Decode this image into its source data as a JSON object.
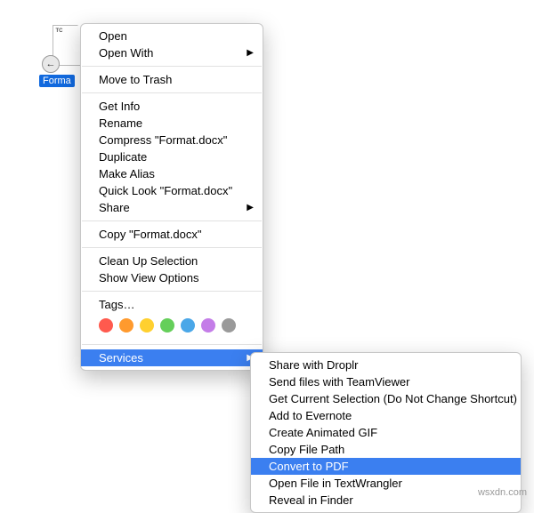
{
  "file": {
    "badge": "TC",
    "recent_glyph": "←",
    "label": "Forma"
  },
  "primary_menu": {
    "groups": [
      {
        "items": [
          {
            "label": "Open",
            "submenu": false
          },
          {
            "label": "Open With",
            "submenu": true
          }
        ]
      },
      {
        "items": [
          {
            "label": "Move to Trash",
            "submenu": false
          }
        ]
      },
      {
        "items": [
          {
            "label": "Get Info",
            "submenu": false
          },
          {
            "label": "Rename",
            "submenu": false
          },
          {
            "label": "Compress \"Format.docx\"",
            "submenu": false
          },
          {
            "label": "Duplicate",
            "submenu": false
          },
          {
            "label": "Make Alias",
            "submenu": false
          },
          {
            "label": "Quick Look \"Format.docx\"",
            "submenu": false
          },
          {
            "label": "Share",
            "submenu": true
          }
        ]
      },
      {
        "items": [
          {
            "label": "Copy \"Format.docx\"",
            "submenu": false
          }
        ]
      },
      {
        "items": [
          {
            "label": "Clean Up Selection",
            "submenu": false
          },
          {
            "label": "Show View Options",
            "submenu": false
          }
        ]
      },
      {
        "items": [
          {
            "label": "Tags…",
            "submenu": false,
            "tags": true
          }
        ]
      },
      {
        "items": [
          {
            "label": "Services",
            "submenu": true,
            "highlight": true
          }
        ]
      }
    ]
  },
  "secondary_menu": {
    "items": [
      {
        "label": "Share with Droplr"
      },
      {
        "label": "Send files with TeamViewer"
      },
      {
        "label": "Get Current Selection (Do Not Change Shortcut)"
      },
      {
        "label": "Add to Evernote"
      },
      {
        "label": "Create Animated GIF"
      },
      {
        "label": "Copy File Path"
      },
      {
        "label": "Convert to PDF",
        "highlight": true
      },
      {
        "label": "Open File in TextWrangler"
      },
      {
        "label": "Reveal in Finder"
      }
    ]
  },
  "tag_colors": [
    "#ff5a4e",
    "#ff9a2e",
    "#ffd02f",
    "#65cf5a",
    "#4aa7e8",
    "#c47de8",
    "#9a9a9a"
  ],
  "watermark": "wsxdn.com"
}
